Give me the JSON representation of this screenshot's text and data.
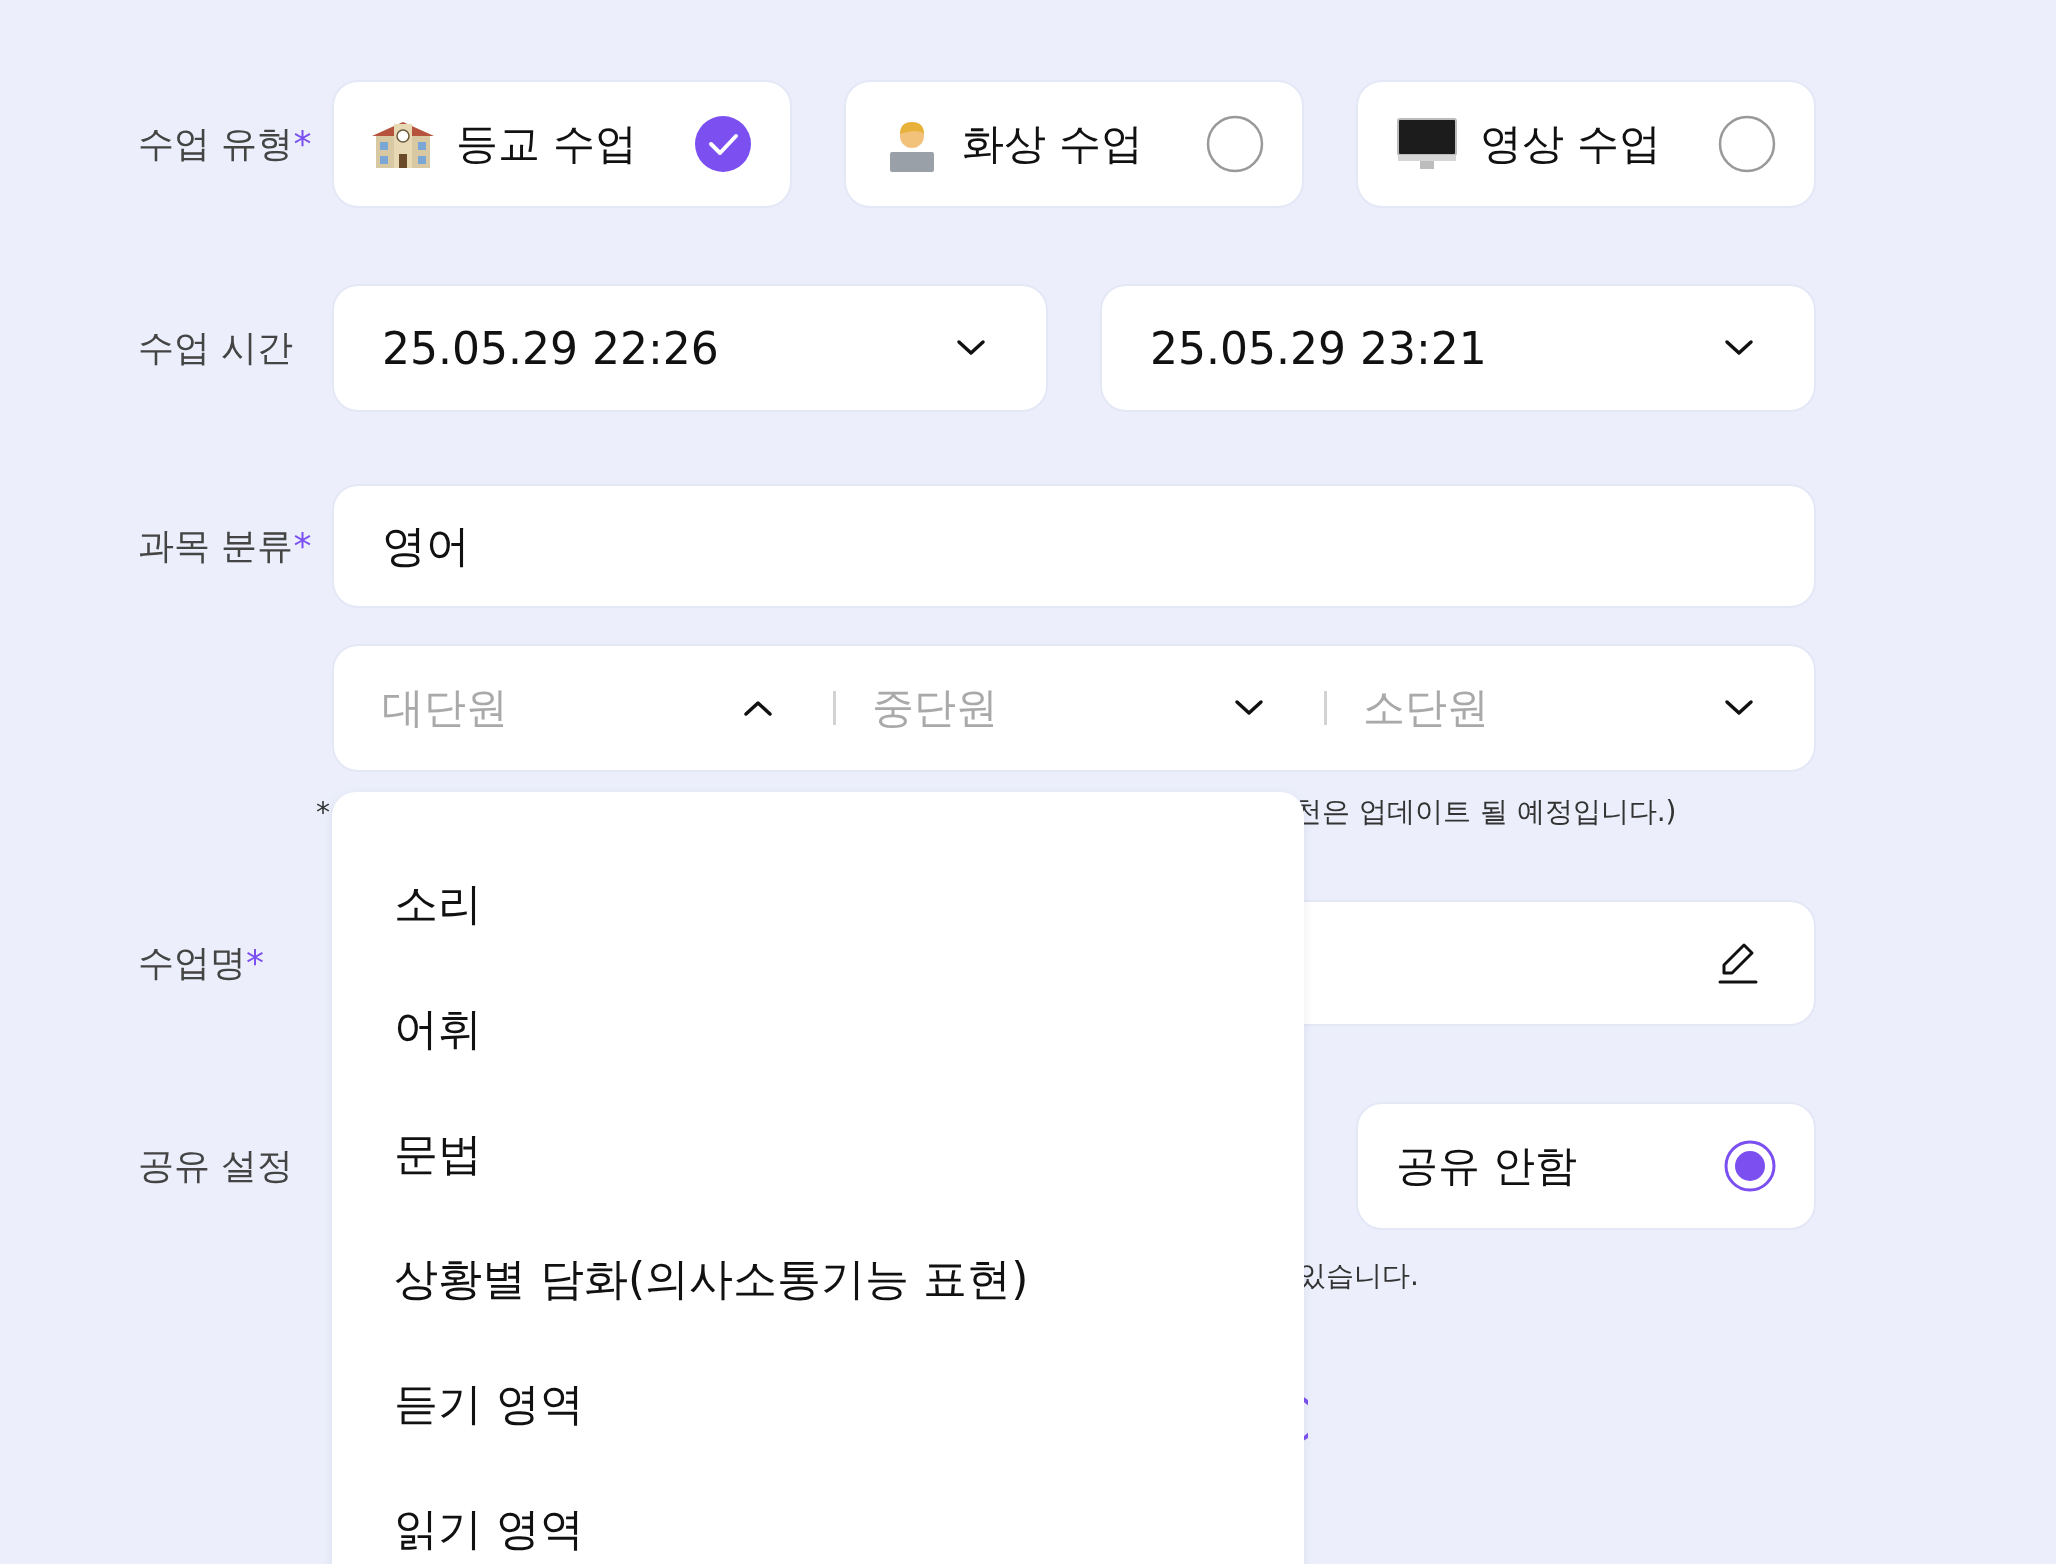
{
  "lesson_type": {
    "label": "수업 유형",
    "required_mark": "*",
    "options": [
      {
        "label": "등교 수업",
        "selected": true
      },
      {
        "label": "화상 수업",
        "selected": false
      },
      {
        "label": "영상 수업",
        "selected": false
      }
    ]
  },
  "lesson_time": {
    "label": "수업 시간",
    "start": "25.05.29 22:26",
    "end": "25.05.29 23:21"
  },
  "subject": {
    "label": "과목 분류",
    "required_mark": "*",
    "value": "영어",
    "units": [
      {
        "placeholder": "대단원",
        "expanded": true
      },
      {
        "placeholder": "중단원",
        "expanded": false
      },
      {
        "placeholder": "소단원",
        "expanded": false
      }
    ],
    "note_start": "*",
    "note_end": "천은 업데이트 될 예정입니다.)"
  },
  "lesson_name": {
    "label": "수업명",
    "required_mark": "*"
  },
  "sharing": {
    "label": "공유 설정",
    "options": [
      {
        "label": "공유 안함",
        "selected": true
      }
    ],
    "note": "있습니다."
  },
  "dropdown": {
    "items": [
      "소리",
      "어휘",
      "문법",
      "상황별 담화(의사소통기능 표현)",
      "듣기 영역",
      "읽기 영역"
    ]
  }
}
